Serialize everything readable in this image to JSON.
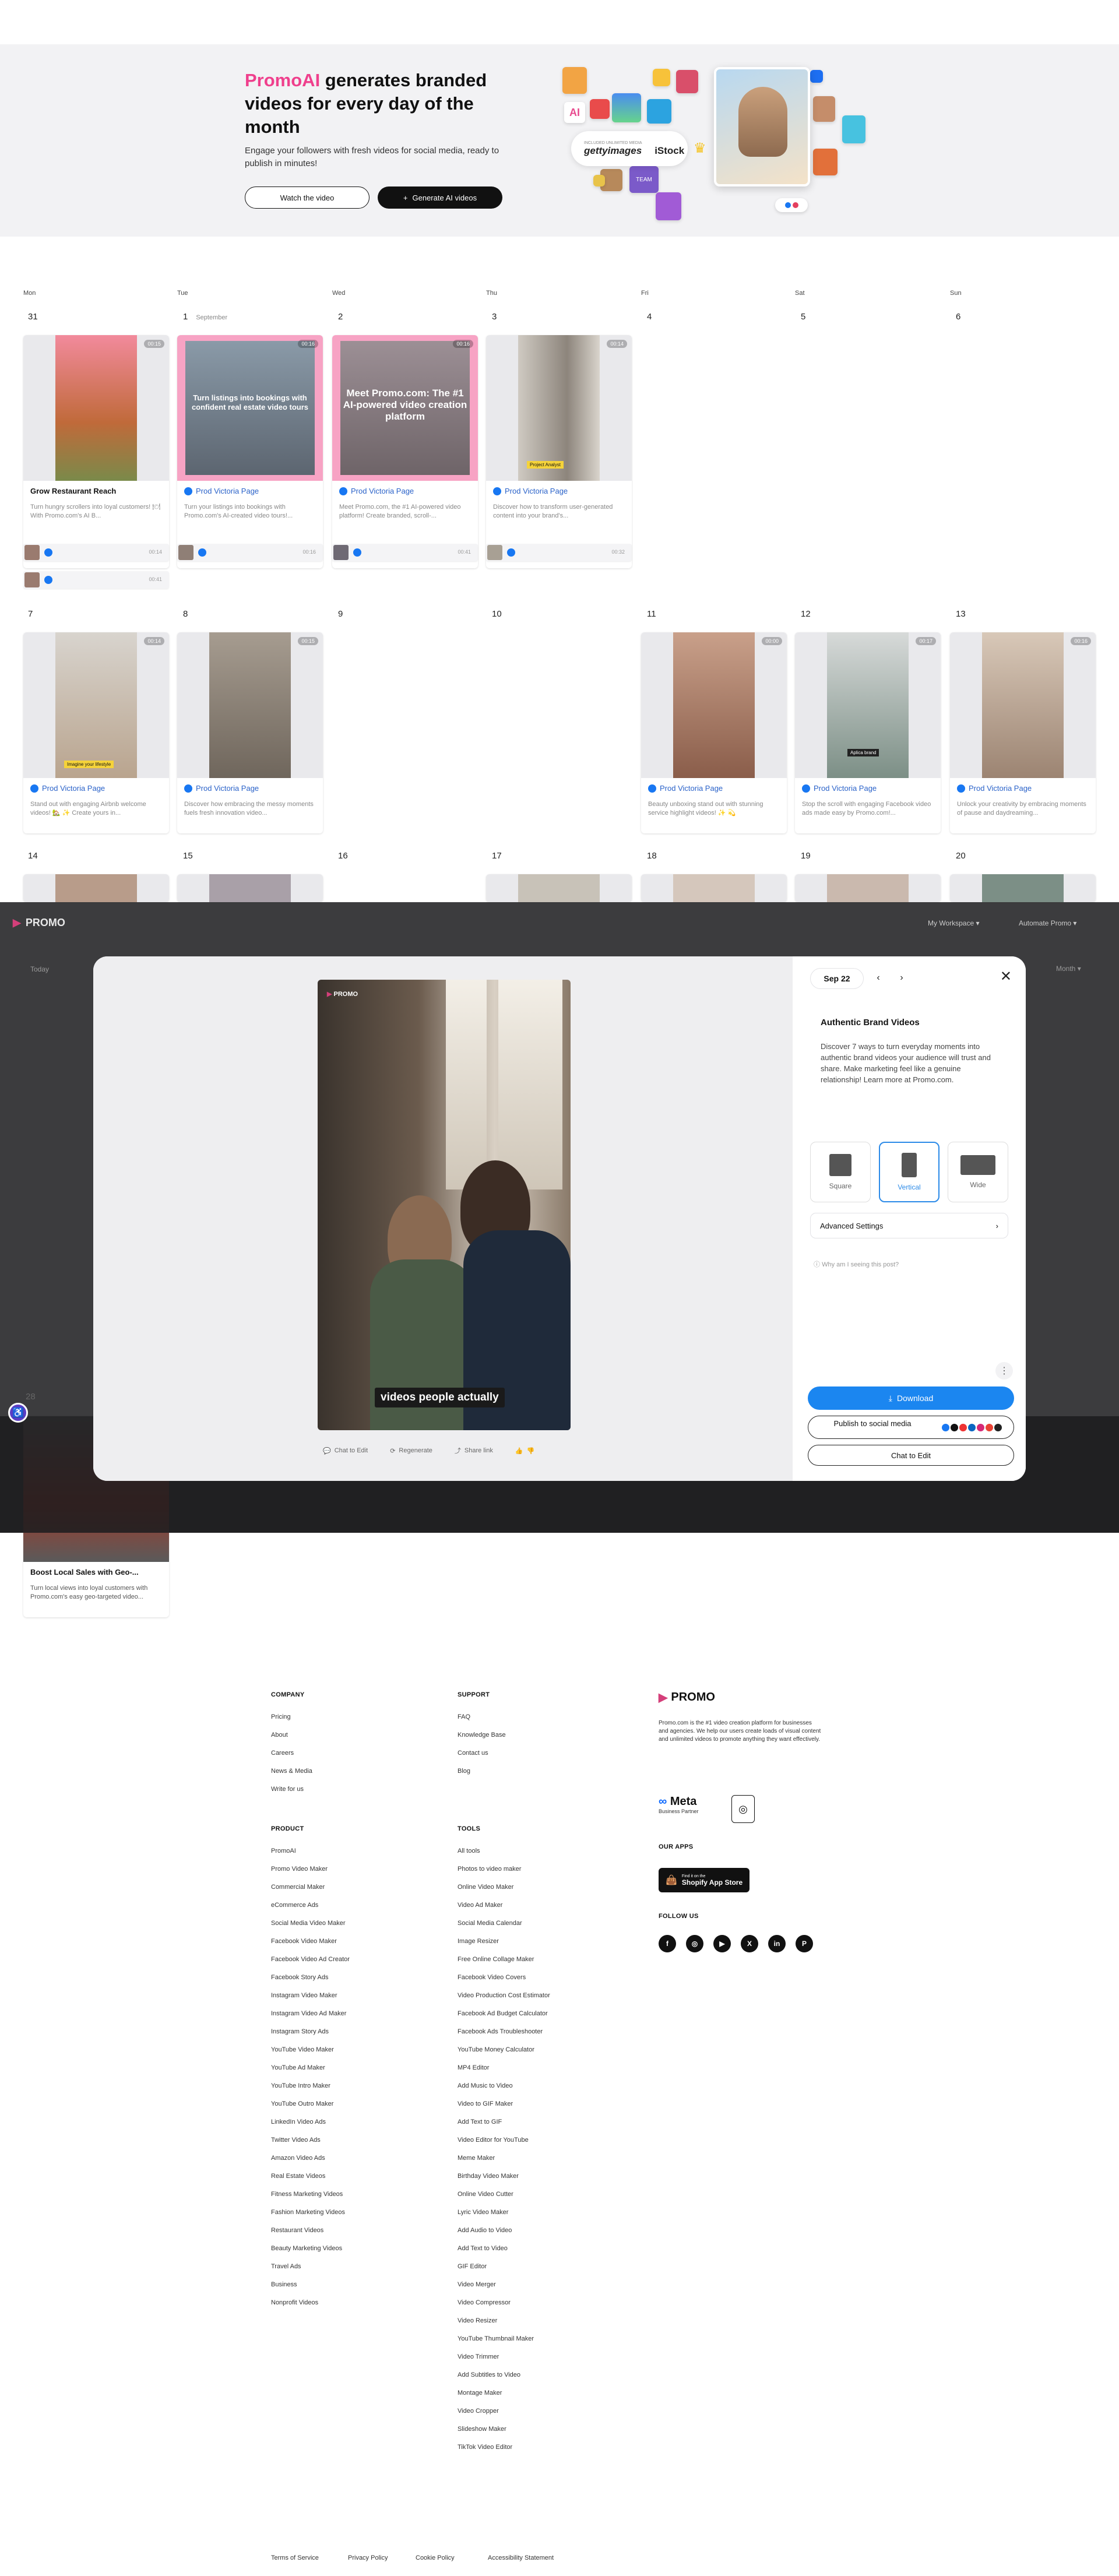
{
  "hero": {
    "brand": "PromoAI",
    "title_rest": " generates branded videos for every day of the month",
    "subtitle": "Engage your followers with fresh videos for social media, ready to publish in minutes!",
    "watch_label": "Watch the video",
    "generate_label": "Generate AI videos",
    "included_media": "INCLUDED UNLIMITED MEDIA",
    "logo_getty": "gettyimages",
    "logo_istock": "iStock"
  },
  "calendar": {
    "weekdays": [
      "Mon",
      "Tue",
      "Wed",
      "Thu",
      "Fri",
      "Sat",
      "Sun"
    ],
    "month_label": "September",
    "week1": [
      "31",
      "1",
      "2",
      "3",
      "4",
      "5",
      "6"
    ],
    "week2": [
      "7",
      "8",
      "9",
      "10",
      "11",
      "12",
      "13"
    ],
    "week3": [
      "14",
      "15",
      "16",
      "17",
      "18",
      "19",
      "20"
    ],
    "week5_day": "28",
    "card_overlay_1": "Turn listings into bookings with confident real estate video tours",
    "card_overlay_2": "Meet Promo.com: The #1 AI-powered video creation platform",
    "cards": [
      {
        "title": "Grow Restaurant Reach",
        "desc": "Turn hungry scrollers into loyal customers! 🍽 With Promo.com's AI B...",
        "dur": "00:15"
      },
      {
        "title": "Prod Victoria Page",
        "desc": "Turn your listings into bookings with Promo.com's AI-created video tours!...",
        "dur": "00:16"
      },
      {
        "title": "Prod Victoria Page",
        "desc": "Meet Promo.com, the #1 AI-powered video platform! Create branded, scroll-...",
        "dur": "00:16"
      },
      {
        "title": "Prod Victoria Page",
        "desc": "Discover how to transform user-generated content into your brand's...",
        "dur": "00:14"
      },
      {
        "title": "Prod Victoria Page",
        "desc": "Stand out with engaging Airbnb welcome videos! 🏡 ✨ Create yours in...",
        "dur": "00:14"
      },
      {
        "title": "Prod Victoria Page",
        "desc": "Discover how embracing the messy moments fuels fresh innovation video...",
        "dur": "00:15"
      },
      {
        "title": "Prod Victoria Page",
        "desc": "Beauty unboxing stand out with stunning service highlight videos! ✨ 💫",
        "dur": "00:00"
      },
      {
        "title": "Prod Victoria Page",
        "desc": "Stop the scroll with engaging Facebook video ads made easy by Promo.com!...",
        "dur": "00:17"
      },
      {
        "title": "Prod Victoria Page",
        "desc": "Unlock your creativity by embracing moments of pause and daydreaming...",
        "dur": "00:16"
      },
      {
        "title": "Boost Local Sales with Geo-...",
        "desc": "Turn local views into loyal customers with Promo.com's easy geo-targeted video...",
        "dur": ""
      }
    ],
    "subrow_times": [
      "00:14",
      "00:41",
      "00:16",
      "00:41",
      "00:32"
    ],
    "thumb_label_1": "Imagine your lifestyle",
    "thumb_label_2": "Aplica brand",
    "thumb_label_3": "Project Analyst"
  },
  "topbar": {
    "logo": "PROMO",
    "today": "Today",
    "workspace": "My Workspace",
    "automate": "Automate Promo",
    "month": "Month"
  },
  "modal": {
    "date": "Sep 22",
    "title": "Authentic Brand Videos",
    "description": "Discover 7 ways to turn everyday moments into authentic brand videos your audience will trust and share. Make marketing feel like a genuine relationship! Learn more at Promo.com.",
    "formats": [
      "Square",
      "Vertical",
      "Wide"
    ],
    "advanced": "Advanced Settings",
    "why": "Why am I seeing this post?",
    "download": "Download",
    "publish": "Publish to social media",
    "chat": "Chat to Edit",
    "caption": "videos people actually",
    "video_logo": "PROMO",
    "tools": [
      "Chat to Edit",
      "Regenerate",
      "Share link"
    ]
  },
  "footer": {
    "company_h": "COMPANY",
    "company": [
      "Pricing",
      "About",
      "Careers",
      "News & Media",
      "Write for us"
    ],
    "support_h": "SUPPORT",
    "support": [
      "FAQ",
      "Knowledge Base",
      "Contact us",
      "Blog"
    ],
    "product_h": "PRODUCT",
    "product": [
      "PromoAI",
      "Promo Video Maker",
      "Commercial Maker",
      "eCommerce Ads",
      "Social Media Video Maker",
      "Facebook Video Maker",
      "Facebook Video Ad Creator",
      "Facebook Story Ads",
      "Instagram Video Maker",
      "Instagram Video Ad Maker",
      "Instagram Story Ads",
      "YouTube Video Maker",
      "YouTube Ad Maker",
      "YouTube Intro Maker",
      "YouTube Outro Maker",
      "LinkedIn Video Ads",
      "Twitter Video Ads",
      "Amazon Video Ads",
      "Real Estate Videos",
      "Fitness Marketing Videos",
      "Fashion Marketing Videos",
      "Restaurant Videos",
      "Beauty Marketing Videos",
      "Travel Ads",
      "Business",
      "Nonprofit Videos"
    ],
    "tools_h": "TOOLS",
    "tools": [
      "All tools",
      "Photos to video maker",
      "Online Video Maker",
      "Video Ad Maker",
      "Social Media Calendar",
      "Image Resizer",
      "Free Online Collage Maker",
      "Facebook Video Covers",
      "Video Production Cost Estimator",
      "Facebook Ad Budget Calculator",
      "Facebook Ads Troubleshooter",
      "YouTube Money Calculator",
      "MP4 Editor",
      "Add Music to Video",
      "Video to GIF Maker",
      "Add Text to GIF",
      "Video Editor for YouTube",
      "Meme Maker",
      "Birthday Video Maker",
      "Online Video Cutter",
      "Lyric Video Maker",
      "Add Audio to Video",
      "Add Text to Video",
      "GIF Editor",
      "Video Merger",
      "Video Compressor",
      "Video Resizer",
      "YouTube Thumbnail Maker",
      "Video Trimmer",
      "Add Subtitles to Video",
      "Montage Maker",
      "Video Cropper",
      "Slideshow Maker",
      "TikTok Video Editor"
    ],
    "brand": "PROMO",
    "about": "Promo.com is the #1 video creation platform for businesses and agencies. We help our users create loads of visual content and unlimited videos to promote anything they want effectively.",
    "meta": "Meta",
    "meta_sub": "Business Partner",
    "apps_h": "OUR APPS",
    "app_store": "Shopify App Store",
    "app_store_small": "Find it on the",
    "follow_h": "FOLLOW US",
    "bottom": [
      "Terms of Service",
      "Privacy Policy",
      "Cookie Policy",
      "Accessibility Statement"
    ]
  },
  "colors": {
    "brand_pink": "#ef3f8c",
    "accent_blue": "#1b86f0",
    "facebook": "#1877f2"
  }
}
